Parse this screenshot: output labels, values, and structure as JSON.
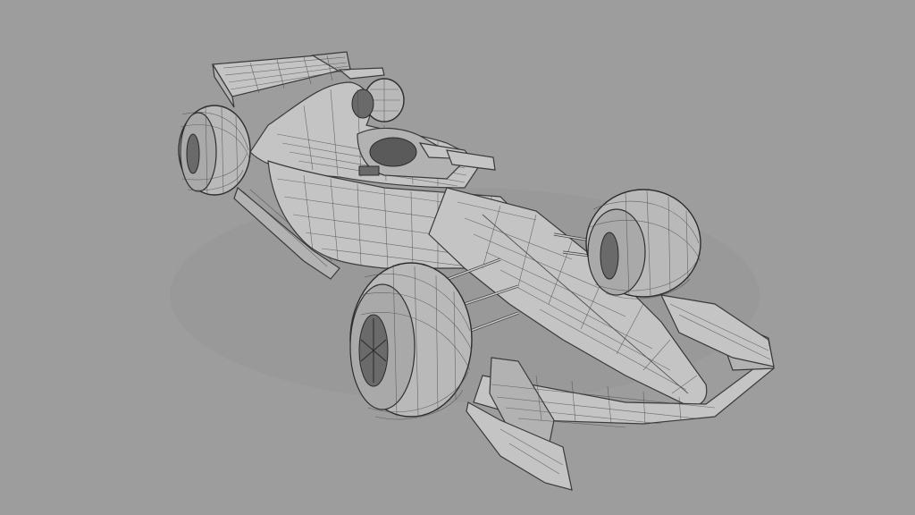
{
  "scene": {
    "subject": "race-car-wireframe-model",
    "colors": {
      "background": "#9d9d9d",
      "surface": "#c4c4c4",
      "wire": "#3a3a3a"
    }
  }
}
